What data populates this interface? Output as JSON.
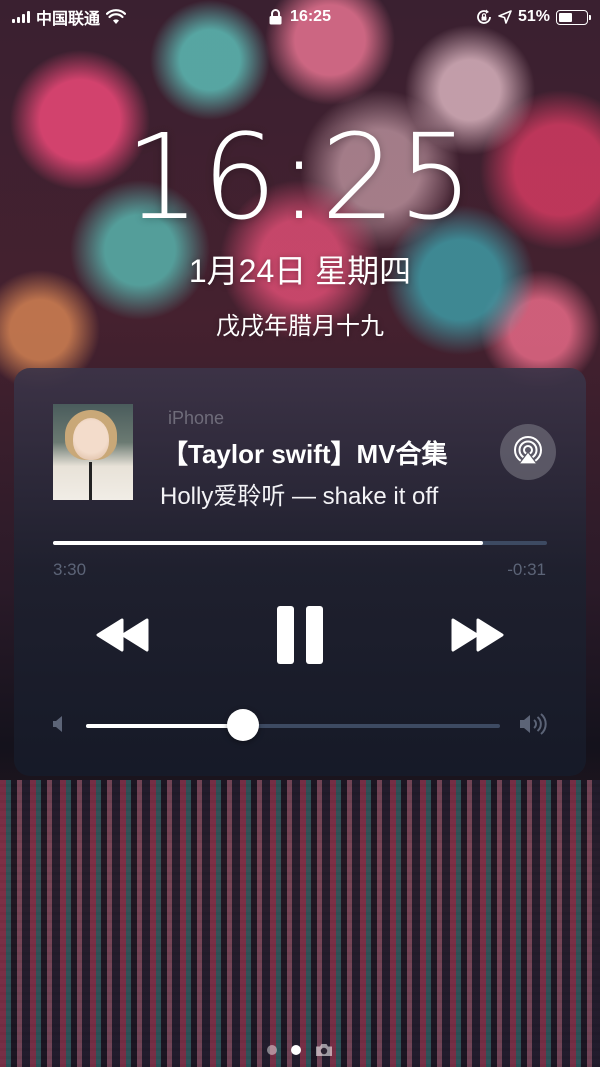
{
  "status_bar": {
    "carrier": "中国联通",
    "time": "16:25",
    "battery_percent": "51%",
    "battery_level": 0.51,
    "icons": [
      "signal-icon",
      "wifi-icon",
      "lock-icon",
      "orientation-lock-icon",
      "location-icon",
      "battery-icon"
    ]
  },
  "lock_screen": {
    "clock": "16:25",
    "date": "1月24日 星期四",
    "lunar_date": "戊戌年腊月十九"
  },
  "now_playing": {
    "device": "iPhone",
    "title": "【Taylor swift】MV合集",
    "subtitle": "Holly爱聆听 — shake it off",
    "elapsed": "3:30",
    "remaining": "-0:31",
    "progress_fraction": 0.87,
    "volume_fraction": 0.38,
    "controls": [
      "rewind-icon",
      "pause-icon",
      "fast-forward-icon",
      "airplay-icon"
    ]
  },
  "page_dots": {
    "count": 2,
    "active_index": 1,
    "trailing_icon": "camera-icon"
  },
  "colors": {
    "accent": "#ffffff",
    "muted_text": "#5c6477",
    "device_label": "#6f6c7a",
    "track": "#3d4a62"
  }
}
